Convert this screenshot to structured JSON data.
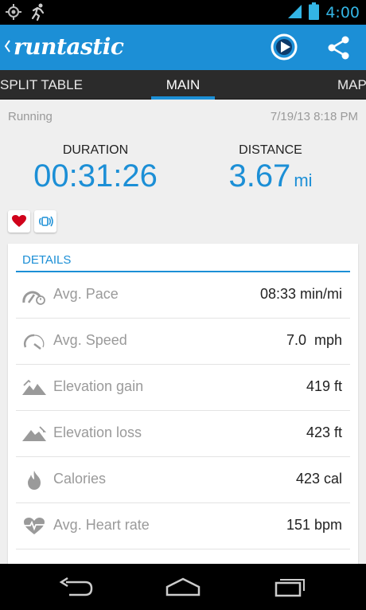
{
  "status_bar": {
    "time": "4:00",
    "icons": [
      "gps-icon",
      "runner-notification-icon",
      "signal-icon",
      "battery-icon"
    ]
  },
  "action_bar": {
    "app_name": "runtastic",
    "icons": [
      "back-chevron-icon",
      "play-circle-icon",
      "share-icon"
    ],
    "accent_color": "#1c8fd6"
  },
  "tabs": [
    {
      "label": "SPLIT TABLE",
      "selected": false
    },
    {
      "label": "MAIN",
      "selected": true
    },
    {
      "label": "MAP",
      "selected": false
    }
  ],
  "summary": {
    "activity_type": "Running",
    "date": "7/19/13 8:18 PM",
    "duration_label": "DURATION",
    "duration_value": "00:31:26",
    "distance_label": "DISTANCE",
    "distance_value": "3.67",
    "distance_unit": "mi"
  },
  "badges": [
    "heart-icon",
    "sensor-icon"
  ],
  "details": {
    "title": "DETAILS",
    "rows": [
      {
        "icon": "pace-icon",
        "label": "Avg. Pace",
        "value": "08:33 min/mi"
      },
      {
        "icon": "speedometer-icon",
        "label": "Avg. Speed",
        "value": "7.0  mph"
      },
      {
        "icon": "elevation-gain-icon",
        "label": "Elevation gain",
        "value": "419 ft"
      },
      {
        "icon": "elevation-loss-icon",
        "label": "Elevation loss",
        "value": "423 ft"
      },
      {
        "icon": "flame-icon",
        "label": "Calories",
        "value": "423 cal"
      },
      {
        "icon": "heart-rate-icon",
        "label": "Avg. Heart rate",
        "value": "151 bpm"
      }
    ]
  },
  "nav_bar": {
    "icons": [
      "nav-back-icon",
      "nav-home-icon",
      "nav-recents-icon"
    ]
  }
}
